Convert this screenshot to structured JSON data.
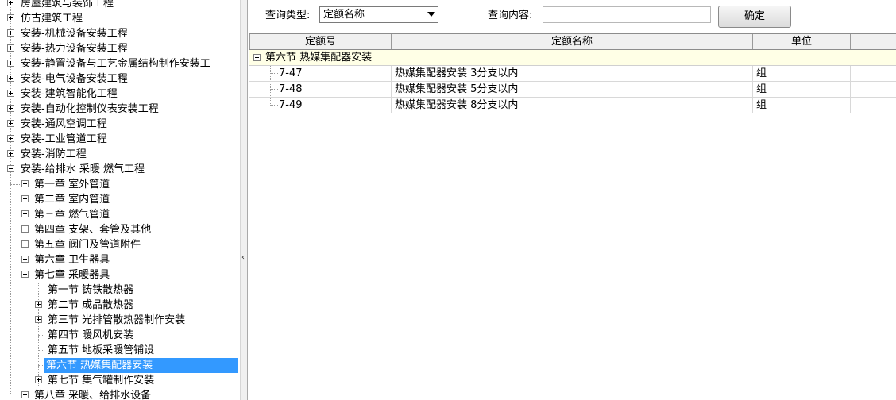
{
  "tree": {
    "top_items": [
      "房屋建筑与装饰工程",
      "仿古建筑工程",
      "安装-机械设备安装工程",
      "安装-热力设备安装工程",
      "安装-静置设备与工艺金属结构制作安装工",
      "安装-电气设备安装工程",
      "安装-建筑智能化工程",
      "安装-自动化控制仪表安装工程",
      "安装-通风空调工程",
      "安装-工业管道工程",
      "安装-消防工程",
      "安装-给排水 采暖 燃气工程"
    ],
    "chapters": [
      "第一章 室外管道",
      "第二章 室内管道",
      "第三章 燃气管道",
      "第四章 支架、套管及其他",
      "第五章 阀门及管道附件",
      "第六章 卫生器具",
      "第七章 采暖器具"
    ],
    "sections": [
      "第一节 铸铁散热器",
      "第二节 成品散热器",
      "第三节 光排管散热器制作安装",
      "第四节 暖风机安装",
      "第五节 地板采暖管铺设",
      "第六节 热媒集配器安装",
      "第七节 集气罐制作安装"
    ],
    "next_chapter": "第八章 采暖、给排水设备"
  },
  "toolbar": {
    "query_type_label": "查询类型:",
    "query_type_value": "定额名称",
    "query_content_label": "查询内容:",
    "query_content_value": "",
    "ok_label": "确定"
  },
  "grid": {
    "columns": [
      "定额号",
      "定额名称",
      "单位"
    ],
    "group_title": "第六节 热媒集配器安装",
    "rows": [
      {
        "code": "7-47",
        "name": "热媒集配器安装 3分支以内",
        "unit": "组"
      },
      {
        "code": "7-48",
        "name": "热媒集配器安装 5分支以内",
        "unit": "组"
      },
      {
        "code": "7-49",
        "name": "热媒集配器安装 8分支以内",
        "unit": "组"
      }
    ]
  },
  "colors": {
    "selection": "#3399ff",
    "group_row_bg": "#ffffe6",
    "header_bg": "#f0f0f0"
  }
}
